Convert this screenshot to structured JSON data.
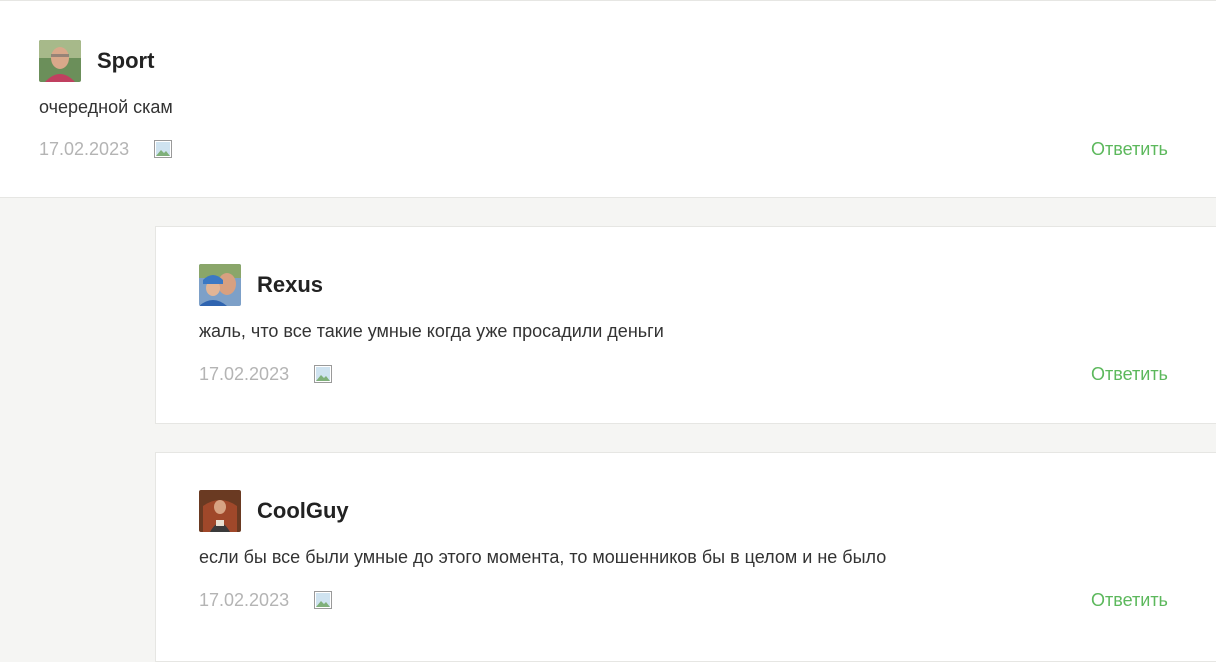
{
  "comments": [
    {
      "author": "Sport",
      "text": "очередной скам",
      "date": "17.02.2023",
      "reply_label": "Ответить",
      "avatar_icon": "user-photo-avatar",
      "media_icon": "image-icon"
    },
    {
      "author": "Rexus",
      "text": "жаль, что все такие умные когда уже просадили деньги",
      "date": "17.02.2023",
      "reply_label": "Ответить",
      "avatar_icon": "user-photo-avatar",
      "media_icon": "image-icon"
    },
    {
      "author": "CoolGuy",
      "text": "если бы все были умные до этого момента, то мошенников бы в целом и не было",
      "date": "17.02.2023",
      "reply_label": "Ответить",
      "avatar_icon": "user-photo-avatar",
      "media_icon": "image-icon"
    }
  ],
  "colors": {
    "background": "#f5f5f3",
    "card": "#ffffff",
    "reply": "#5cb85c",
    "date": "#b4b4b4",
    "text": "#333333"
  }
}
